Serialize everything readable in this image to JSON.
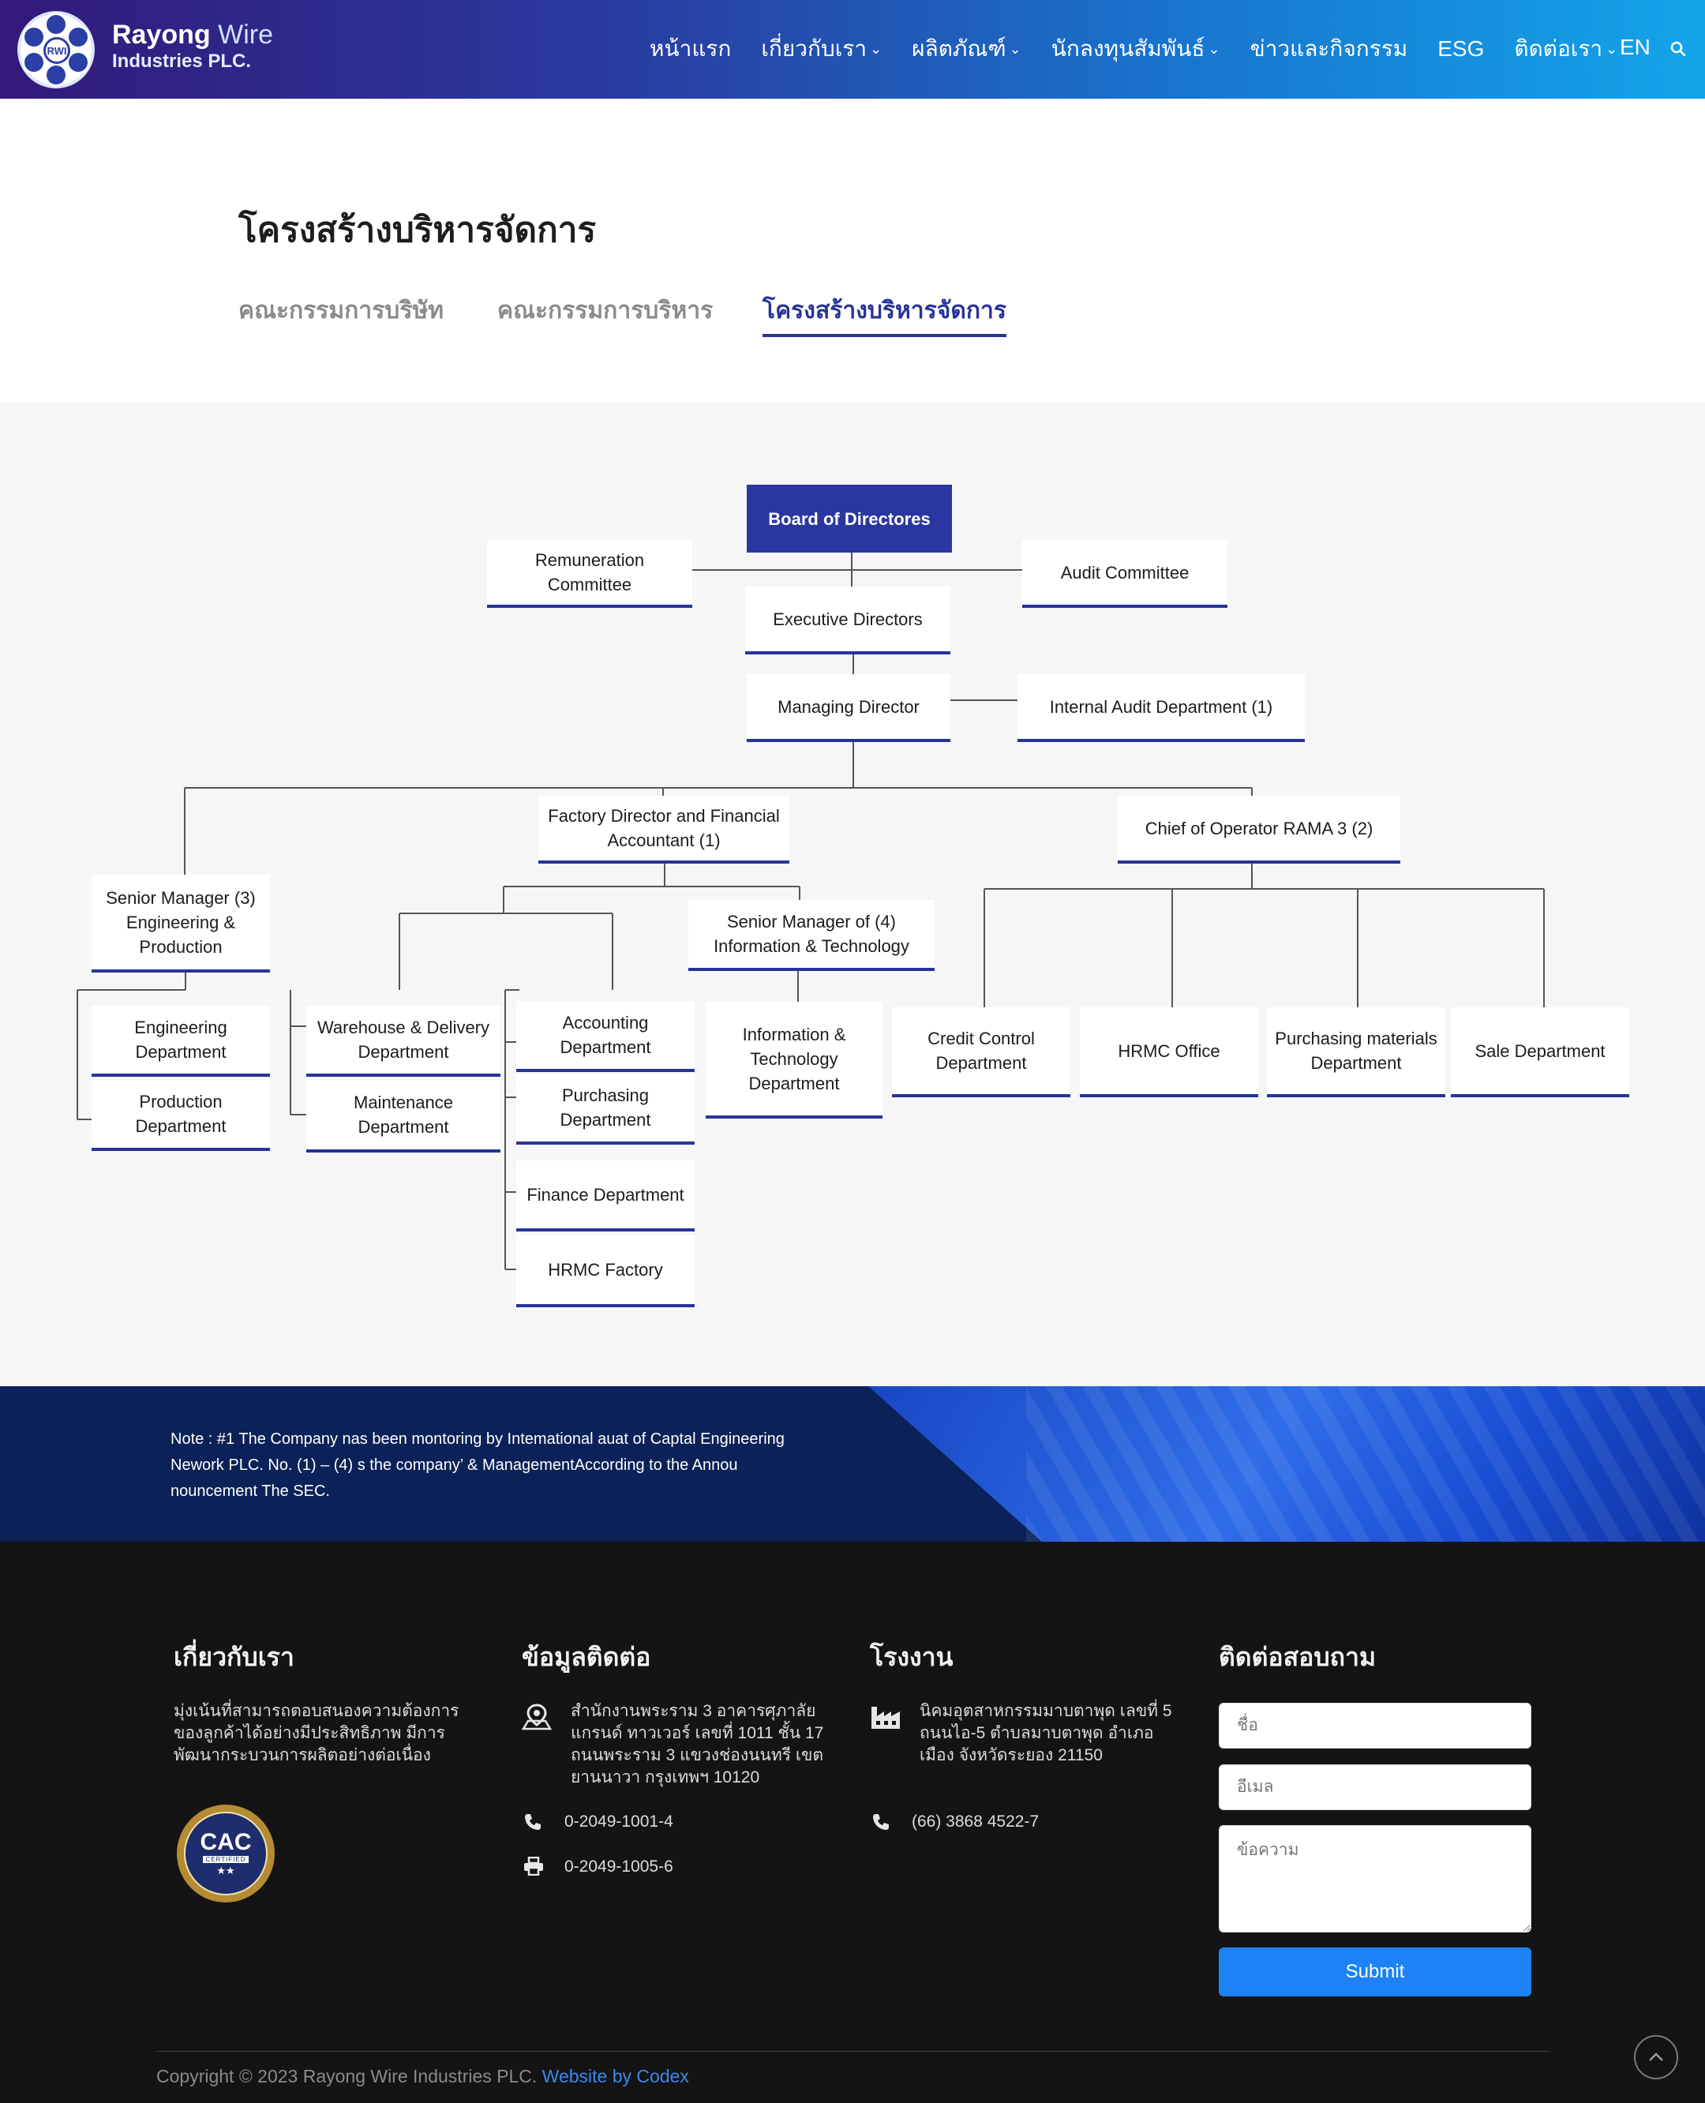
{
  "header": {
    "logo_badge": "RWI",
    "brand_line1_a": "Rayong",
    "brand_line1_b": "Wire",
    "brand_line2": "Industries PLC.",
    "nav": [
      {
        "label": "หน้าแรก",
        "has_dropdown": false
      },
      {
        "label": "เกี่ยวกับเรา",
        "has_dropdown": true
      },
      {
        "label": "ผลิตภัณฑ์",
        "has_dropdown": true
      },
      {
        "label": "นักลงทุนสัมพันธ์",
        "has_dropdown": true
      },
      {
        "label": "ข่าวและกิจกรรม",
        "has_dropdown": false
      },
      {
        "label": "ESG",
        "has_dropdown": false
      },
      {
        "label": "ติดต่อเรา",
        "has_dropdown": true
      }
    ],
    "language": "EN",
    "chevron": "⌄"
  },
  "page": {
    "title": "โครงสร้างบริหารจัดการ",
    "tabs": [
      {
        "label": "คณะกรรมการบริษัท",
        "active": false
      },
      {
        "label": "คณะกรรมการบริหาร",
        "active": false
      },
      {
        "label": "โครงสร้างบริหารจัดการ",
        "active": true
      }
    ]
  },
  "org": {
    "board": "Board of Directores",
    "remuneration": "Remuneration Committee",
    "audit_committee": "Audit Committee",
    "executive": "Executive Directors",
    "managing": "Managing Director",
    "internal_audit": "Internal  Audit Department (1)",
    "factory_director": "Factory Director and Financial Accountant (1)",
    "chief_operator": "Chief of  Operator RAMA 3 (2)",
    "senior_eng": "Senior Manager (3) Engineering & Production",
    "senior_it": "Senior Manager of (4) Information & Technology",
    "engineering_dept": "Engineering Department",
    "production_dept": "Production Department",
    "warehouse_dept": "Warehouse & Delivery Department",
    "maintenance_dept": "Maintenance Department",
    "accounting_dept": "Accounting Department",
    "purchasing_dept": "Purchasing Department",
    "finance_dept": "Finance Department",
    "hrmc_factory": "HRMC Factory",
    "it_dept": "Information & Technology Department",
    "credit_dept": "Credit Control Department",
    "hrmc_office": "HRMC Office",
    "purchasing_materials": "Purchasing materials Department",
    "sale_dept": "Sale Department"
  },
  "note": {
    "text": "Note : #1 The Company nas been montoring by Intemational auat of Captal Engineering Nework PLC. No. (1) – (4) s the company’ & ManagementAccording to the Annou nouncement The SEC."
  },
  "footer": {
    "about": {
      "heading": "เกี่ยวกับเรา",
      "text": "มุ่งเน้นที่สามารถตอบสนองความต้องการของลูกค้าได้อย่างมีประสิทธิภาพ มีการพัฒนากระบวนการผลิตอย่างต่อเนื่อง",
      "badge_big": "CAC",
      "badge_small": "CERTIFIED",
      "badge_stars": "★★"
    },
    "contact": {
      "heading": "ข้อมูลติดต่อ",
      "address": "สำนักงานพระราม 3 อาคารศุภาลัย แกรนด์ ทาวเวอร์ เลขที่ 1011 ชั้น 17 ถนนพระราม 3 แขวงช่องนนทรี เขตยานนาวา กรุงเทพฯ 10120",
      "phone": "0-2049-1001-4",
      "fax": "0-2049-1005-6"
    },
    "factory": {
      "heading": "โรงงาน",
      "address": "นิคมอุตสาหกรรมมาบตาพุด เลขที่ 5 ถนนไอ-5 ตำบลมาบตาพุด อำเภอเมือง จังหวัดระยอง 21150",
      "phone": "(66) 3868 4522-7"
    },
    "inquiry": {
      "heading": "ติดต่อสอบถาม",
      "name_placeholder": "ชื่อ",
      "email_placeholder": "อีเมล",
      "message_placeholder": "ข้อความ",
      "submit": "Submit"
    },
    "copyright": "Copyright © 2023 Rayong Wire Industries PLC.",
    "credit": "Website by Codex"
  },
  "colors": {
    "brand_navy": "#27339a",
    "board_fill": "#2a37a2",
    "submit_blue": "#1d82f5",
    "footer_bg": "#141414",
    "link_blue": "#3c87f0"
  }
}
